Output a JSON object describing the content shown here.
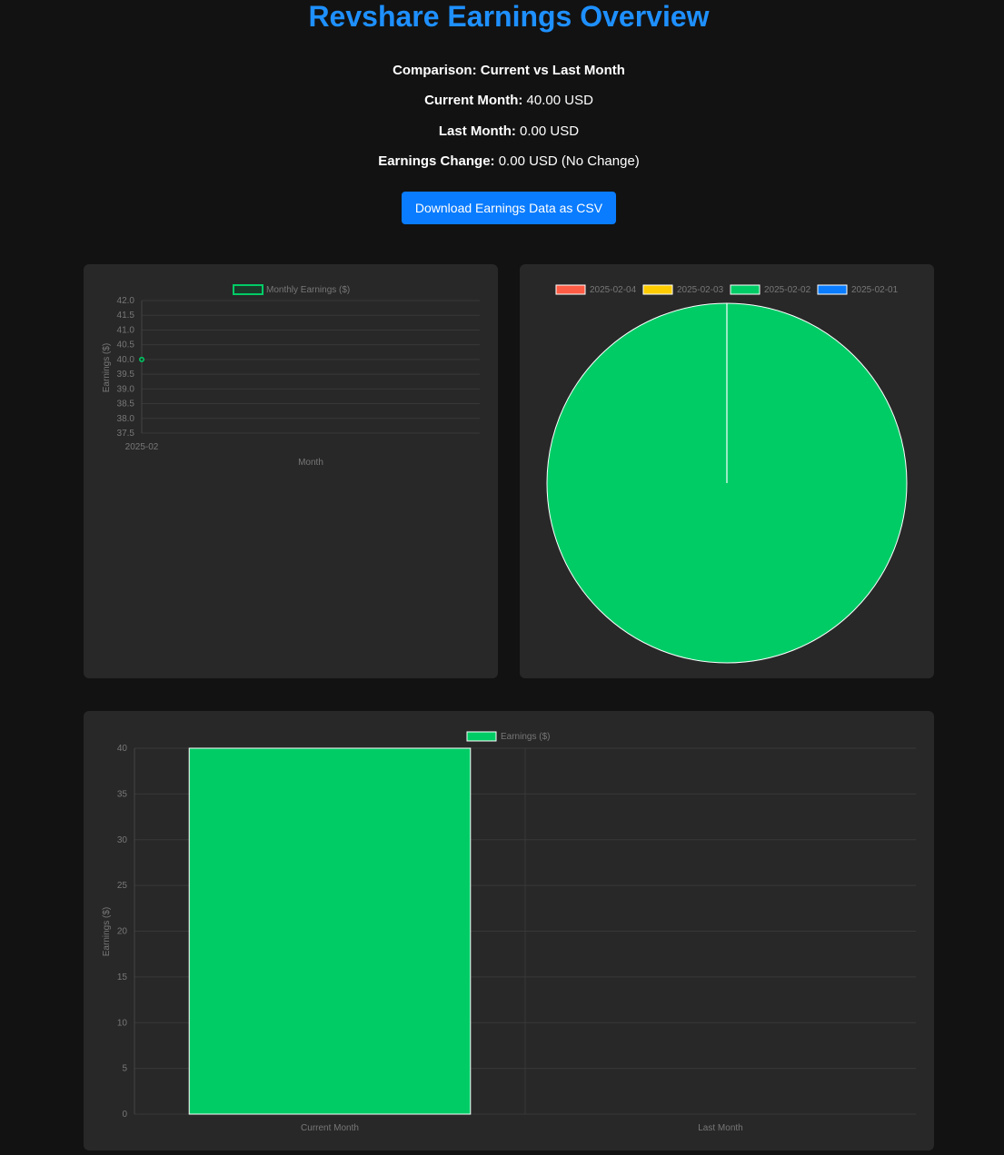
{
  "header": {
    "title": "Revshare Earnings Overview"
  },
  "summary": {
    "comparison_label": "Comparison: Current vs Last Month",
    "current_label": "Current Month:",
    "current_value": "40.00 USD",
    "last_label": "Last Month:",
    "last_value": "0.00 USD",
    "change_label": "Earnings Change:",
    "change_value": "0.00 USD (No Change)"
  },
  "actions": {
    "download_label": "Download Earnings Data as CSV"
  },
  "colors": {
    "accent_blue": "#1e90ff",
    "button_blue": "#0a7cff",
    "green": "#00cc66",
    "red": "#ff5c45",
    "yellow": "#ffcc00",
    "blue_slice": "#0a7cff"
  },
  "chart_data": [
    {
      "type": "line",
      "legend": "Monthly Earnings ($)",
      "x": [
        "2025-02"
      ],
      "series": [
        {
          "name": "Monthly Earnings ($)",
          "values": [
            40
          ]
        }
      ],
      "xlabel": "Month",
      "ylabel": "Earnings ($)",
      "ylim": [
        37.5,
        42.0
      ],
      "yticks": [
        "42.0",
        "41.5",
        "41.0",
        "40.5",
        "40.0",
        "39.5",
        "39.0",
        "38.5",
        "38.0",
        "37.5"
      ],
      "grid": true,
      "legend_position": "top"
    },
    {
      "type": "pie",
      "labels": [
        "2025-02-04",
        "2025-02-03",
        "2025-02-02",
        "2025-02-01"
      ],
      "values": [
        0,
        0,
        40,
        0
      ],
      "colors": [
        "#ff5c45",
        "#ffcc00",
        "#00cc66",
        "#0a7cff"
      ],
      "legend_position": "top"
    },
    {
      "type": "bar",
      "legend": "Earnings ($)",
      "categories": [
        "Current Month",
        "Last Month"
      ],
      "values": [
        40,
        0
      ],
      "ylabel": "Earnings ($)",
      "ylim": [
        0,
        40
      ],
      "yticks": [
        "40",
        "35",
        "30",
        "25",
        "20",
        "15",
        "10",
        "5",
        "0"
      ],
      "grid": true,
      "legend_position": "top"
    }
  ]
}
